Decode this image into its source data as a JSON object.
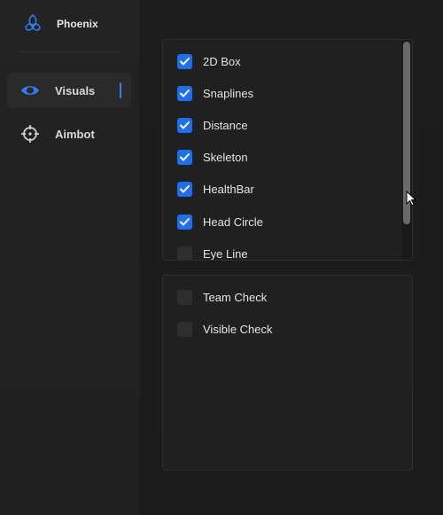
{
  "brand": {
    "name": "Phoenix",
    "icon": "phoenix-logo-icon"
  },
  "sidebar": {
    "items": [
      {
        "label": "Visuals",
        "icon": "eye-icon",
        "active": true
      },
      {
        "label": "Aimbot",
        "icon": "crosshair-icon",
        "active": false
      }
    ]
  },
  "visuals_panel": {
    "options": [
      {
        "label": "2D Box",
        "checked": true
      },
      {
        "label": "Snaplines",
        "checked": true
      },
      {
        "label": "Distance",
        "checked": true
      },
      {
        "label": "Skeleton",
        "checked": true
      },
      {
        "label": "HealthBar",
        "checked": true
      },
      {
        "label": "Head Circle",
        "checked": true
      },
      {
        "label": "Eye Line",
        "checked": false
      }
    ]
  },
  "checks_panel": {
    "options": [
      {
        "label": "Team Check",
        "checked": false
      },
      {
        "label": "Visible Check",
        "checked": false
      }
    ]
  },
  "colors": {
    "accent": "#1d6ff2",
    "background": "#1b1b1b",
    "panel": "#202020"
  }
}
